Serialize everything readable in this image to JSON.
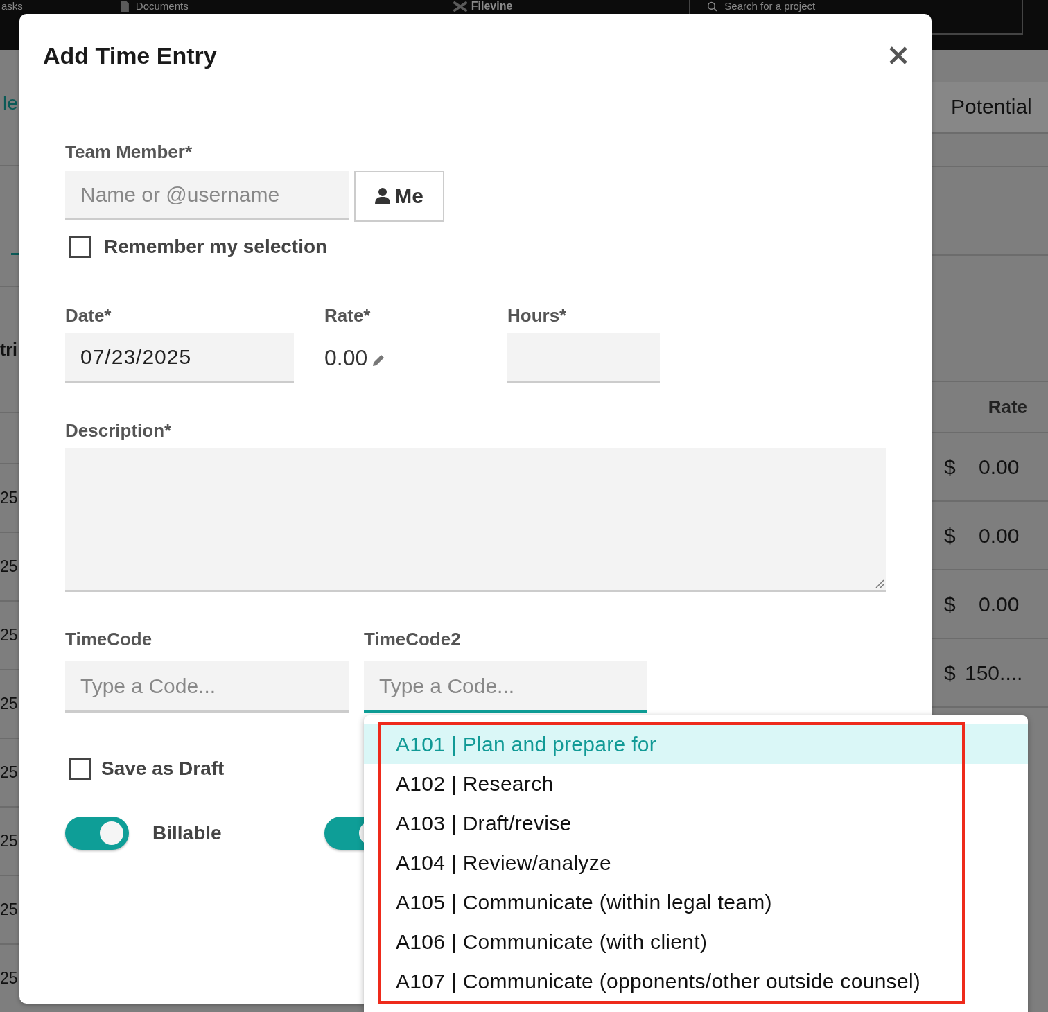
{
  "background": {
    "top_bar": {
      "nav_items": [
        "asks",
        "Documents"
      ],
      "logo": "Filevine",
      "search": {
        "placeholder": "Search for a project"
      }
    },
    "left_fragments": {
      "tab": "le",
      "heading": "tri",
      "rows": [
        "25",
        "25",
        "25",
        "25",
        "25",
        "25",
        "25",
        "25"
      ]
    },
    "right_panel": {
      "tab": "Potential",
      "column": "Rate",
      "rows": [
        {
          "currency": "$",
          "amount": "0.00"
        },
        {
          "currency": "$",
          "amount": "0.00"
        },
        {
          "currency": "$",
          "amount": "0.00"
        },
        {
          "currency": "$",
          "amount": "150...."
        }
      ]
    }
  },
  "modal": {
    "title": "Add Time Entry",
    "team_member": {
      "label": "Team Member*",
      "placeholder": "Name or @username",
      "me_button": "Me"
    },
    "remember": {
      "label": "Remember my selection",
      "checked": false
    },
    "date": {
      "label": "Date*",
      "value": "07/23/2025"
    },
    "rate": {
      "label": "Rate*",
      "value": "0.00"
    },
    "hours": {
      "label": "Hours*"
    },
    "description": {
      "label": "Description*"
    },
    "timecodes": [
      {
        "label": "TimeCode",
        "placeholder": "Type a Code...",
        "focused": false
      },
      {
        "label": "TimeCode2",
        "placeholder": "Type a Code...",
        "focused": true
      }
    ],
    "save_draft": {
      "label": "Save as Draft",
      "checked": false
    },
    "toggles": [
      {
        "label": "Billable",
        "on": true
      },
      {
        "on": true
      }
    ]
  },
  "dropdown": {
    "options": [
      {
        "label": "A101 | Plan and prepare for",
        "selected": true
      },
      {
        "label": "A102 | Research",
        "selected": false
      },
      {
        "label": "A103 | Draft/revise",
        "selected": false
      },
      {
        "label": "A104 | Review/analyze",
        "selected": false
      },
      {
        "label": "A105 | Communicate (within legal team)",
        "selected": false
      },
      {
        "label": "A106 | Communicate (with client)",
        "selected": false
      },
      {
        "label": "A107 | Communicate (opponents/other outside counsel)",
        "selected": false
      }
    ]
  }
}
